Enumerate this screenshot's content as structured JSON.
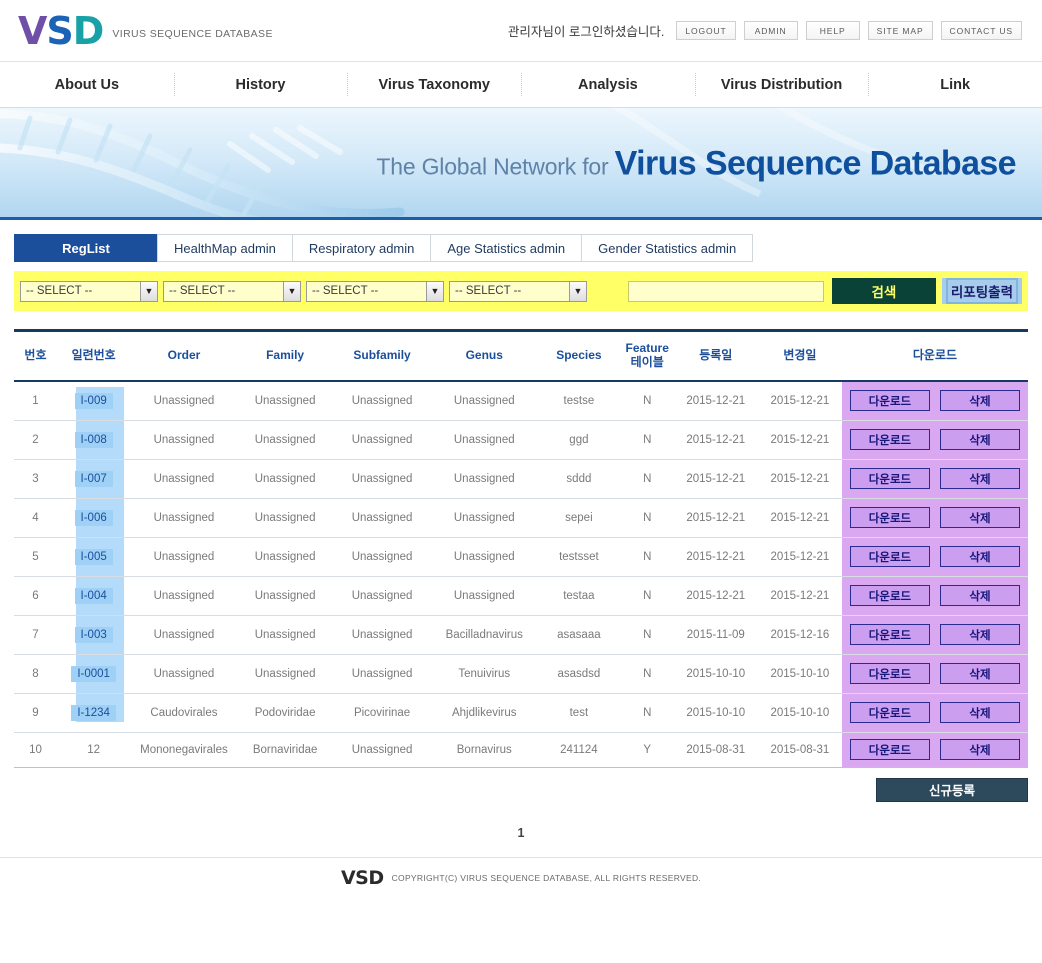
{
  "header": {
    "logo_main": "VSD",
    "logo_v": "V",
    "logo_s": "S",
    "logo_d": "D",
    "logo_subtitle": "VIRUS SEQUENCE DATABASE",
    "login_message": "관리자님이 로그인하셨습니다.",
    "buttons": [
      {
        "label": "LOGOUT",
        "name": "logout-button"
      },
      {
        "label": "ADMIN",
        "name": "admin-button"
      },
      {
        "label": "HELP",
        "name": "help-button"
      },
      {
        "label": "SITE MAP",
        "name": "site-map-button"
      },
      {
        "label": "CONTACT US",
        "name": "contact-us-button"
      }
    ]
  },
  "nav": {
    "items": [
      {
        "label": "About Us"
      },
      {
        "label": "History"
      },
      {
        "label": "Virus Taxonomy"
      },
      {
        "label": "Analysis"
      },
      {
        "label": "Virus Distribution"
      },
      {
        "label": "Link"
      }
    ]
  },
  "hero": {
    "lead": "The Global Network for ",
    "title": "Virus Sequence Database"
  },
  "tabs": [
    {
      "label": "RegList",
      "active": true
    },
    {
      "label": "HealthMap admin",
      "active": false
    },
    {
      "label": "Respiratory admin",
      "active": false
    },
    {
      "label": "Age Statistics admin",
      "active": false
    },
    {
      "label": "Gender Statistics admin",
      "active": false
    }
  ],
  "filter": {
    "select_placeholder": "-- SELECT --",
    "selects": [
      {
        "value": "-- SELECT --",
        "name": "order-select"
      },
      {
        "value": "-- SELECT --",
        "name": "family-select"
      },
      {
        "value": "-- SELECT --",
        "name": "subfamily-select"
      },
      {
        "value": "-- SELECT --",
        "name": "genus-select"
      }
    ],
    "keyword_value": "",
    "keyword_placeholder": "",
    "search_label": "검색",
    "report_label": "리포팅출력"
  },
  "table": {
    "columns": [
      {
        "label": "번호"
      },
      {
        "label": "일련번호"
      },
      {
        "label": "Order"
      },
      {
        "label": "Family"
      },
      {
        "label": "Subfamily"
      },
      {
        "label": "Genus"
      },
      {
        "label": "Species"
      },
      {
        "label": "Feature 테이블",
        "line1": "Feature",
        "line2": "테이블"
      },
      {
        "label": "등록일"
      },
      {
        "label": "변경일"
      },
      {
        "label": "다운로드"
      }
    ],
    "download_label": "다운로드",
    "delete_label": "삭제",
    "rows": [
      {
        "no": "1",
        "serial": "I-009",
        "highlight": true,
        "order": "Unassigned",
        "family": "Unassigned",
        "subfamily": "Unassigned",
        "genus": "Unassigned",
        "species": "testse",
        "feature": "N",
        "reg": "2015-12-21",
        "mod": "2015-12-21"
      },
      {
        "no": "2",
        "serial": "I-008",
        "highlight": true,
        "order": "Unassigned",
        "family": "Unassigned",
        "subfamily": "Unassigned",
        "genus": "Unassigned",
        "species": "ggd",
        "feature": "N",
        "reg": "2015-12-21",
        "mod": "2015-12-21"
      },
      {
        "no": "3",
        "serial": "I-007",
        "highlight": true,
        "order": "Unassigned",
        "family": "Unassigned",
        "subfamily": "Unassigned",
        "genus": "Unassigned",
        "species": "sddd",
        "feature": "N",
        "reg": "2015-12-21",
        "mod": "2015-12-21"
      },
      {
        "no": "4",
        "serial": "I-006",
        "highlight": true,
        "order": "Unassigned",
        "family": "Unassigned",
        "subfamily": "Unassigned",
        "genus": "Unassigned",
        "species": "sepei",
        "feature": "N",
        "reg": "2015-12-21",
        "mod": "2015-12-21"
      },
      {
        "no": "5",
        "serial": "I-005",
        "highlight": true,
        "order": "Unassigned",
        "family": "Unassigned",
        "subfamily": "Unassigned",
        "genus": "Unassigned",
        "species": "testsset",
        "feature": "N",
        "reg": "2015-12-21",
        "mod": "2015-12-21"
      },
      {
        "no": "6",
        "serial": "I-004",
        "highlight": true,
        "order": "Unassigned",
        "family": "Unassigned",
        "subfamily": "Unassigned",
        "genus": "Unassigned",
        "species": "testaa",
        "feature": "N",
        "reg": "2015-12-21",
        "mod": "2015-12-21"
      },
      {
        "no": "7",
        "serial": "I-003",
        "highlight": true,
        "order": "Unassigned",
        "family": "Unassigned",
        "subfamily": "Unassigned",
        "genus": "Bacilladnavirus",
        "species": "asasaaa",
        "feature": "N",
        "reg": "2015-11-09",
        "mod": "2015-12-16"
      },
      {
        "no": "8",
        "serial": "I-0001",
        "highlight": true,
        "order": "Unassigned",
        "family": "Unassigned",
        "subfamily": "Unassigned",
        "genus": "Tenuivirus",
        "species": "asasdsd",
        "feature": "N",
        "reg": "2015-10-10",
        "mod": "2015-10-10"
      },
      {
        "no": "9",
        "serial": "I-1234",
        "highlight": true,
        "order": "Caudovirales",
        "family": "Podoviridae",
        "subfamily": "Picovirinae",
        "genus": "Ahjdlikevirus",
        "species": "test",
        "feature": "N",
        "reg": "2015-10-10",
        "mod": "2015-10-10"
      },
      {
        "no": "10",
        "serial": "12",
        "highlight": false,
        "order": "Mononegavirales",
        "family": "Bornaviridae",
        "subfamily": "Unassigned",
        "genus": "Bornavirus",
        "species": "241124",
        "feature": "Y",
        "reg": "2015-08-31",
        "mod": "2015-08-31"
      }
    ]
  },
  "actions": {
    "new_label": "신규등록"
  },
  "pagination": {
    "current": "1"
  },
  "footer": {
    "logo": "VSD",
    "copyright": "COPYRIGHT(C) VIRUS SEQUENCE DATABASE, ALL RIGHTS RESERVED."
  },
  "colors": {
    "accent_blue": "#1b4f9c",
    "nav_border": "#dcdcdc",
    "filter_yellow": "#ffff66",
    "search_green": "#0b4238",
    "report_blue": "#a8cdea",
    "download_purple": "#d9a8f0",
    "serial_highlight": "#9fd0f5",
    "header_navy": "#173a63"
  }
}
